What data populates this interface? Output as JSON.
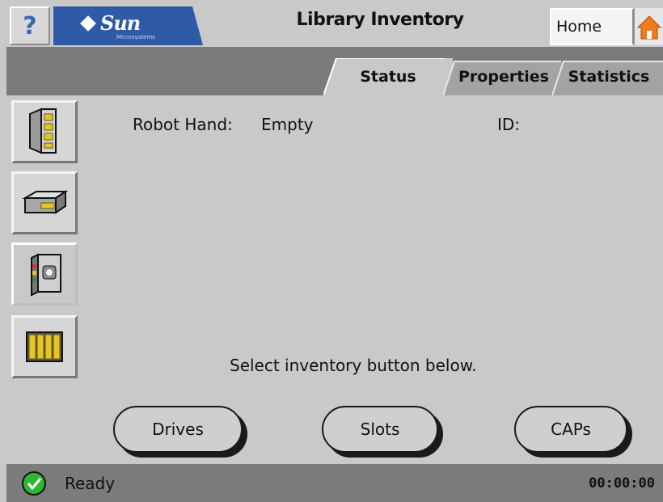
{
  "header": {
    "help_label": "?",
    "logo_text": "Sun",
    "logo_sub": "Microsystems",
    "title": "Library Inventory",
    "home_label": "Home"
  },
  "tabs": [
    {
      "label": "Status",
      "active": true
    },
    {
      "label": "Properties",
      "active": false
    },
    {
      "label": "Statistics",
      "active": false
    }
  ],
  "sidebar": [
    {
      "name": "library-icon",
      "active": false
    },
    {
      "name": "drive-icon",
      "active": false
    },
    {
      "name": "cartridge-icon",
      "active": true
    },
    {
      "name": "slots-icon",
      "active": false
    }
  ],
  "content": {
    "robot_hand_label": "Robot Hand:",
    "robot_hand_value": "Empty",
    "id_label": "ID:",
    "instructions": "Select inventory button below."
  },
  "buttons": {
    "drives": "Drives",
    "slots": "Slots",
    "caps": "CAPs"
  },
  "status": {
    "text": "Ready",
    "clock": "00:00:00"
  },
  "colors": {
    "background": "#c9c9c9",
    "bar": "#7b7b7b",
    "logo_blue": "#2f5aa8",
    "home_orange": "#f07b1a",
    "ok_green": "#2fb52f",
    "icon_yellow": "#e6c42a"
  }
}
